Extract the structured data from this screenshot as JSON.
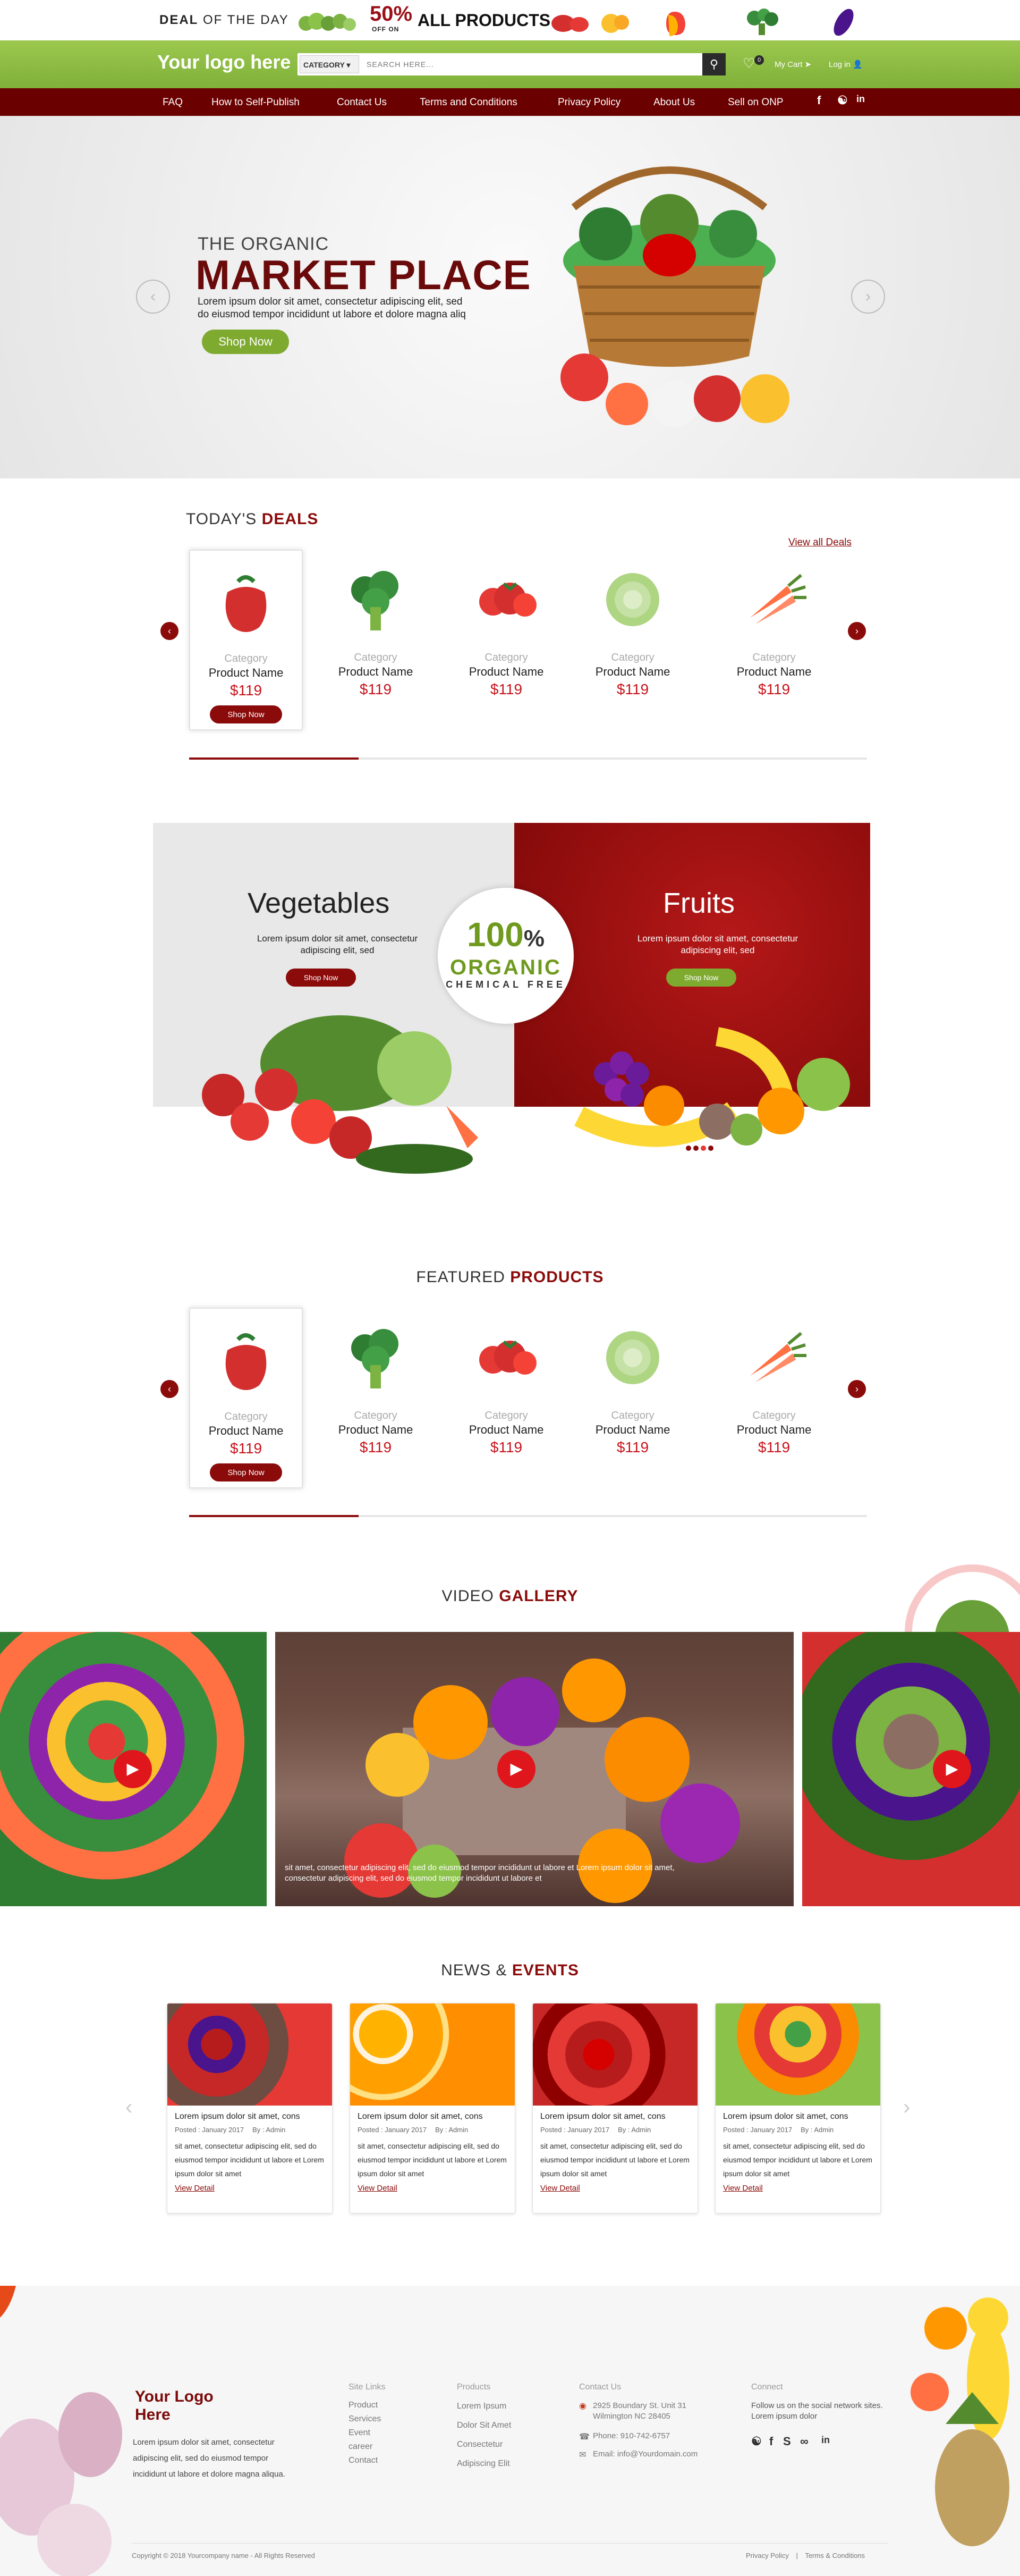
{
  "deal_bar": {
    "deal_prefix": "DEAL",
    "deal_suffix": " OF THE DAY",
    "percent": "50%",
    "off_on": "OFF ON",
    "all_products": "ALL PRODUCTS"
  },
  "header": {
    "logo": "Your logo here",
    "category_label": "CATEGORY ▾",
    "search_placeholder": "SEARCH HERE...",
    "cart_count": "0",
    "cart_label": "My Cart",
    "login_label": "Log in"
  },
  "nav": {
    "items": [
      "FAQ",
      "How to Self-Publish",
      "Contact Us",
      "Terms and Conditions",
      "Privacy Policy",
      "About Us",
      "Sell on ONP"
    ]
  },
  "hero": {
    "pre_title": "THE ORGANIC",
    "title": "MARKET PLACE",
    "description": "Lorem ipsum dolor sit amet, consectetur adipiscing elit, sed do eiusmod tempor incididunt ut labore et dolore magna aliq",
    "button": "Shop Now"
  },
  "deals": {
    "title_plain": "TODAY'S ",
    "title_bold": "DEALS",
    "view_all": "View all Deals",
    "progress": 0.25,
    "products": [
      {
        "category": "Category",
        "name": "Product Name",
        "price": "$119",
        "button": "Shop Now",
        "image": "pepper"
      },
      {
        "category": "Category",
        "name": "Product Name",
        "price": "$119",
        "image": "broccoli"
      },
      {
        "category": "Category",
        "name": "Product Name",
        "price": "$119",
        "image": "tomatoes"
      },
      {
        "category": "Category",
        "name": "Product Name",
        "price": "$119",
        "image": "cabbage"
      },
      {
        "category": "Category",
        "name": "Product Name",
        "price": "$119",
        "image": "carrots"
      }
    ]
  },
  "promo": {
    "veg_title": "Vegetables",
    "veg_desc": "Lorem ipsum dolor sit amet, consectetur adipiscing elit, sed",
    "veg_button": "Shop Now",
    "fruit_title": "Fruits",
    "fruit_desc": "Lorem ipsum dolor sit amet, consectetur adipiscing elit, sed",
    "fruit_button": "Shop Now",
    "badge_pct": "100",
    "badge_pct_sign": "%",
    "badge_word": "ORGANIC",
    "badge_sub": "CHEMICAL FREE"
  },
  "featured": {
    "title_plain": "FEATURED ",
    "title_bold": "PRODUCTS",
    "progress": 0.25,
    "products": [
      {
        "category": "Category",
        "name": "Product Name",
        "price": "$119",
        "button": "Shop Now",
        "image": "pepper"
      },
      {
        "category": "Category",
        "name": "Product Name",
        "price": "$119",
        "image": "broccoli"
      },
      {
        "category": "Category",
        "name": "Product Name",
        "price": "$119",
        "image": "tomatoes"
      },
      {
        "category": "Category",
        "name": "Product Name",
        "price": "$119",
        "image": "cabbage"
      },
      {
        "category": "Category",
        "name": "Product Name",
        "price": "$119",
        "image": "carrots"
      }
    ]
  },
  "video": {
    "title_plain": "VIDEO ",
    "title_bold": "GALLERY",
    "caption": "sit amet, consectetur adipiscing elit, sed do eiusmod tempor incididunt ut labore et Lorem ipsum dolor sit amet, consectetur adipiscing elit, sed do eiusmod tempor incididunt ut labore et"
  },
  "news": {
    "title_plain": "NEWS & ",
    "title_bold": "EVENTS",
    "items": [
      {
        "title": "Lorem ipsum dolor sit amet, cons",
        "posted": "Posted : January 2017",
        "by": "By : Admin",
        "body": "sit amet, consectetur adipiscing elit, sed do eiusmod tempor incididunt ut labore et Lorem ipsum dolor sit amet",
        "link": "View Detail",
        "image": "berries"
      },
      {
        "title": "Lorem ipsum dolor sit amet, cons",
        "posted": "Posted : January 2017",
        "by": "By : Admin",
        "body": "sit amet, consectetur adipiscing elit, sed do eiusmod tempor incididunt ut labore et Lorem ipsum dolor sit amet",
        "link": "View Detail",
        "image": "oranges"
      },
      {
        "title": "Lorem ipsum dolor sit amet, cons",
        "posted": "Posted : January 2017",
        "by": "By : Admin",
        "body": "sit amet, consectetur adipiscing elit, sed do eiusmod tempor incididunt ut labore et Lorem ipsum dolor sit amet",
        "link": "View Detail",
        "image": "strawberries"
      },
      {
        "title": "Lorem ipsum dolor sit amet, cons",
        "posted": "Posted : January 2017",
        "by": "By : Admin",
        "body": "sit amet, consectetur adipiscing elit, sed do eiusmod tempor incididunt ut labore et Lorem ipsum dolor sit amet",
        "link": "View Detail",
        "image": "mixed-fruit"
      }
    ]
  },
  "footer": {
    "logo": "Your Logo Here",
    "about": "Lorem ipsum dolor sit amet, consectetur adipiscing elit, sed do eiusmod tempor incididunt ut labore et dolore magna aliqua.",
    "site_links_head": "Site Links",
    "site_links": [
      "Product",
      "Services",
      "Event",
      "career",
      "Contact"
    ],
    "products_head": "Products",
    "products": [
      "Lorem Ipsum",
      "Dolor Sit Amet",
      "Consectetur",
      "Adipiscing Elit"
    ],
    "contact_head": "Contact Us",
    "address": "2925 Boundary St. Unit 31 Wilmington NC 28405",
    "phone": "Phone: 910-742-6757",
    "email": "Email: info@Yourdomain.com",
    "connect_head": "Connect",
    "connect_text": "Follow us on the social network sites. Lorem ipsum dolor",
    "copyright": "Copyright © 2018 Yourcompany name - All Rights Reserved",
    "privacy": "Privacy Policy",
    "separator": "|",
    "terms": "Terms & Conditions"
  },
  "colors": {
    "brand_red": "#8b0a0a",
    "brand_green": "#7eaa2f",
    "nav_bg": "#6b0000",
    "price_red": "#c8141c"
  }
}
